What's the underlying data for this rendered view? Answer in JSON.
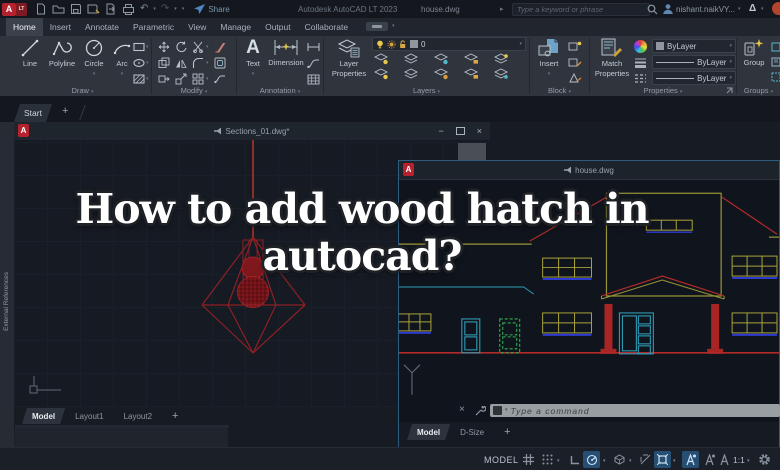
{
  "glyphs": {
    "caret": "▾",
    "arrow": "▸",
    "minimize": "−",
    "close": "×",
    "undo": "↶",
    "redo": "↷",
    "autodesk": "Δ",
    "plus": "+"
  },
  "titlebar": {
    "logo_letter": "A",
    "logo_lt": "LT",
    "share_label": "Share",
    "app_title": "Autodesk AutoCAD LT 2023",
    "doc_title": "house.dwg",
    "search_placeholder": "Type a keyword or phrase",
    "user_name": "nishant.naikVY..."
  },
  "ribbon": {
    "tabs": [
      "Home",
      "Insert",
      "Annotate",
      "Parametric",
      "View",
      "Manage",
      "Output",
      "Collaborate"
    ],
    "active_tab": "Home",
    "draw": {
      "label": "Draw",
      "tools": [
        "Line",
        "Polyline",
        "Circle",
        "Arc"
      ]
    },
    "modify": {
      "label": "Modify"
    },
    "annotation": {
      "label": "Annotation",
      "text_tool": "Text",
      "dimension_tool": "Dimension"
    },
    "layers": {
      "label": "Layers",
      "properties_tool_line1": "Layer",
      "properties_tool_line2": "Properties",
      "current_layer": "0"
    },
    "block": {
      "label": "Block",
      "insert_tool": "Insert"
    },
    "properties": {
      "label": "Properties",
      "match_tool_line1": "Match",
      "match_tool_line2": "Properties",
      "color": "ByLayer",
      "lineweight": "ByLayer",
      "linetype": "ByLayer"
    },
    "groups": {
      "label": "Groups",
      "group_tool": "Group"
    }
  },
  "file_tabs": {
    "start_label": "Start",
    "add_label": "+"
  },
  "palette": {
    "label": "External References"
  },
  "sections_window": {
    "title": "Sections_01.dwg*",
    "tabs": [
      "Model",
      "Layout1",
      "Layout2"
    ],
    "active_tab": "Model",
    "add_label": "+"
  },
  "house_window": {
    "title": "house.dwg",
    "command_placeholder": "Type a command",
    "tabs": [
      "Model",
      "D-Size"
    ],
    "active_tab": "Model",
    "add_label": "+"
  },
  "overlay": {
    "line1": "How to add wood hatch in",
    "line2": "autocad?"
  },
  "statusbar": {
    "model_label": "MODEL",
    "scale_label": "1:1"
  },
  "colors": {
    "accent_red": "#b5222e",
    "ribbon_bg": "#30353d",
    "canvas_bg": "#151a23",
    "highlight_blue": "#264f73",
    "draw_red": "#b02a2a",
    "draw_yellow": "#a8a23b",
    "draw_cyan": "#2e9bb5",
    "draw_blue": "#2d3bd0",
    "draw_green": "#2faf4f"
  }
}
